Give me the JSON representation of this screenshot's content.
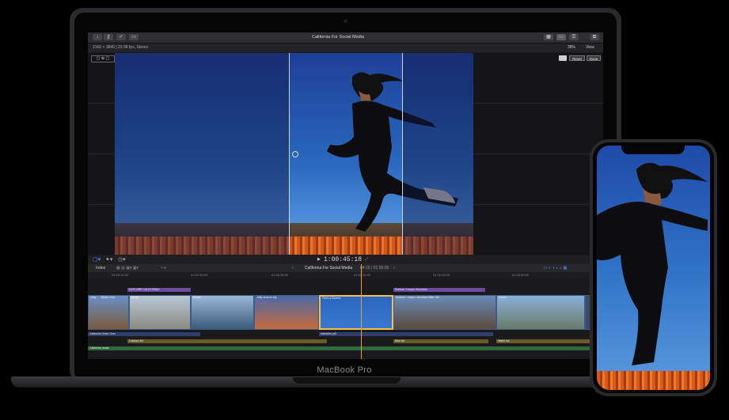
{
  "device": {
    "laptop_label": "MacBook Pro"
  },
  "app": {
    "project_title": "California For Social Media",
    "format_info": "2160 × 3840 | 23.98 fps, Stereo",
    "zoom": "38%",
    "view_menu": "View",
    "reset_button": "Reset",
    "done_button": "Done",
    "timecode": "1:00:45:18",
    "index_button": "Index",
    "timeline_title": "California For Social Media",
    "duration": "04:15 / 01:56:05"
  },
  "ruler": [
    "01:00:25:00",
    "01:00:30:00",
    "01:00:35:00",
    "01:00:40:00",
    "01:00:45:00",
    "01:00:50:00",
    "01:00:55:00",
    "01:01:00:00"
  ],
  "titles": [
    {
      "label": "EXPLORE CALIFORNIA"
    },
    {
      "label": "Sullivan Canyon Mountain"
    }
  ],
  "clips": [
    {
      "label": "Jetty"
    },
    {
      "label": "Black Ulna"
    },
    {
      "label": "Bridge"
    },
    {
      "label": "Beach"
    },
    {
      "label": "Jetty archive clip"
    },
    {
      "label": "Field of flowers"
    },
    {
      "label": "Sullivan Canyon Mountain Bike 360"
    },
    {
      "label": "Canon"
    }
  ],
  "lanes": [
    {
      "label": "California Voice Over"
    },
    {
      "label": "interview pt3"
    },
    {
      "label": "Outdoor sfx"
    },
    {
      "label": "Bike sfx"
    },
    {
      "label": "Water sfx"
    },
    {
      "label": "California music"
    }
  ]
}
